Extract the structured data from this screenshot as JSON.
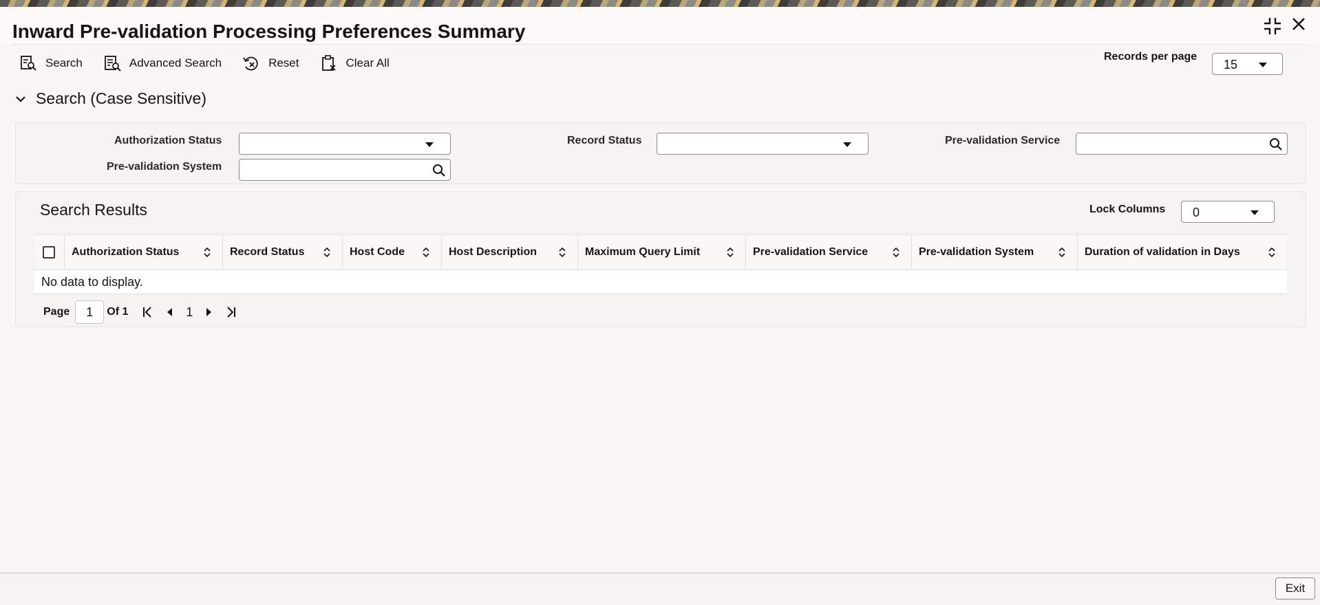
{
  "window": {
    "title": "Inward Pre-validation Processing Preferences Summary"
  },
  "toolbar": {
    "search_label": "Search",
    "advanced_search_label": "Advanced Search",
    "reset_label": "Reset",
    "clear_all_label": "Clear All"
  },
  "records_per_page": {
    "label": "Records per page",
    "value": "15"
  },
  "search_section": {
    "title": "Search (Case Sensitive)",
    "fields": {
      "authorization_status": {
        "label": "Authorization Status",
        "value": ""
      },
      "record_status": {
        "label": "Record Status",
        "value": ""
      },
      "prevalidation_service": {
        "label": "Pre-validation Service",
        "value": ""
      },
      "prevalidation_system": {
        "label": "Pre-validation System",
        "value": ""
      }
    }
  },
  "results": {
    "title": "Search Results",
    "lock_columns_label": "Lock Columns",
    "lock_columns_value": "0",
    "columns": [
      "Authorization Status",
      "Record Status",
      "Host Code",
      "Host Description",
      "Maximum Query Limit",
      "Pre-validation Service",
      "Pre-validation System",
      "Duration of validation in Days"
    ],
    "empty_message": "No data to display."
  },
  "pagination": {
    "page_label": "Page",
    "current_page": "1",
    "of_label": "Of 1",
    "page_number": "1"
  },
  "footer": {
    "exit_label": "Exit"
  },
  "icons": {
    "search": "search-icon",
    "advanced_search": "advanced-search-icon",
    "reset": "reset-icon",
    "clear_all": "clear-all-icon",
    "minimize": "collapse-window-icon",
    "close": "close-icon",
    "lookup": "magnifier-icon",
    "sort": "sort-arrows-icon"
  }
}
